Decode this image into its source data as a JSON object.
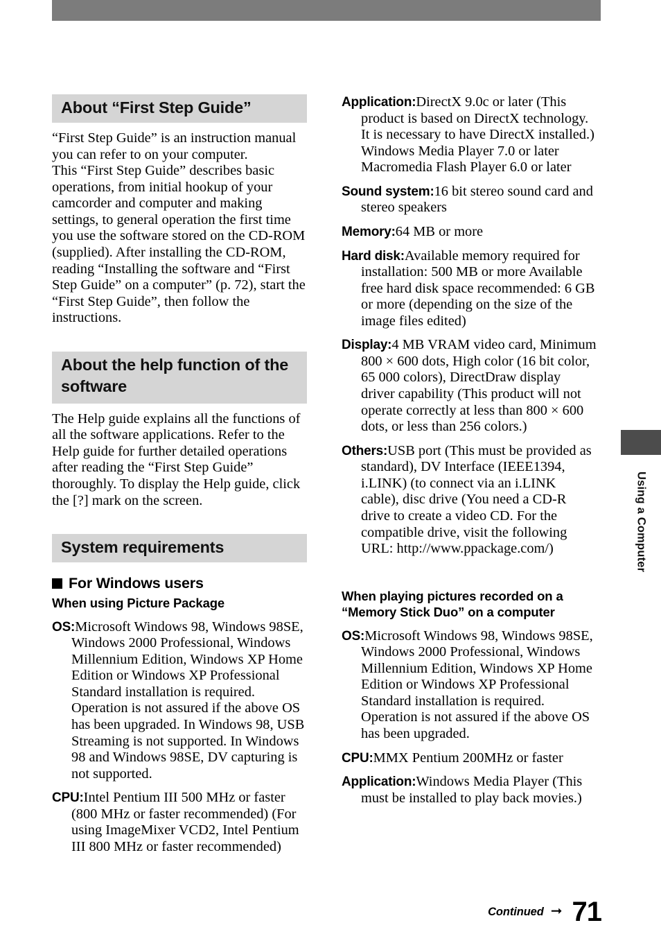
{
  "page": {
    "number": "71",
    "continued_label": "Continued",
    "arrow_icon": "right-arrow-icon",
    "side_tab_label": "Using a Computer"
  },
  "left_column": {
    "heading_1": "About “First Step Guide”",
    "para_1": "“First Step Guide” is an instruction manual you can refer to on your computer.",
    "para_2": "This “First Step Guide” describes basic operations, from initial hookup of your camcorder and computer and making settings, to general operation the first time you use the software stored on the CD-ROM (supplied). After installing the CD-ROM, reading “Installing the software and “First Step Guide” on a computer” (p. 72), start the “First Step Guide”, then follow the instructions.",
    "heading_2": "About the help function of the software",
    "para_3": "The Help guide explains all the functions of all the software applications. Refer to the Help guide for further detailed operations after reading the “First Step Guide” thoroughly. To display the Help guide, click the [?] mark on the screen.",
    "heading_3": "System requirements",
    "subheading_windows": "For Windows users",
    "subheading_picture_package": "When using Picture Package",
    "specs": [
      {
        "term": "OS:",
        "value": "Microsoft Windows 98, Windows 98SE, Windows 2000 Professional, Windows Millennium Edition, Windows XP Home Edition or Windows XP Professional Standard installation is required. Operation is not assured if the above OS has been upgraded. In Windows 98, USB Streaming is not supported. In Windows 98 and Windows 98SE, DV capturing is not supported."
      },
      {
        "term": "CPU:",
        "value": "Intel Pentium III 500 MHz or faster (800 MHz or faster recommended) (For using ImageMixer VCD2, Intel Pentium III 800 MHz or faster recommended)"
      }
    ]
  },
  "right_column": {
    "specs_picture_package": [
      {
        "term": "Application:",
        "value": "DirectX 9.0c or later (This product is based on DirectX technology. It is necessary to have DirectX installed.) Windows Media Player 7.0 or later Macromedia Flash Player 6.0 or later"
      },
      {
        "term": "Sound system:",
        "value": "16 bit stereo sound card and stereo speakers"
      },
      {
        "term": "Memory:",
        "value": "64 MB or more"
      },
      {
        "term": "Hard disk:",
        "value": "Available memory required for installation: 500 MB or more Available free hard disk space recommended: 6 GB or more (depending on the size of the image files edited)"
      },
      {
        "term": "Display:",
        "value": "4 MB VRAM video card, Minimum 800 × 600 dots, High color (16 bit color, 65 000 colors), DirectDraw display driver capability (This product will not operate correctly at less than 800 × 600 dots, or less than 256 colors.)"
      },
      {
        "term": "Others:",
        "value": "USB port (This must be provided as standard), DV Interface (IEEE1394, i.LINK) (to connect via an i.LINK cable), disc drive (You need a CD-R drive to create a video CD. For the compatible drive, visit the following URL: http://www.ppackage.com/)"
      }
    ],
    "subheading_memory_stick": "When playing pictures recorded on a “Memory Stick Duo” on a computer",
    "specs_memory_stick": [
      {
        "term": "OS:",
        "value": "Microsoft Windows 98, Windows 98SE, Windows 2000 Professional, Windows Millennium Edition, Windows XP Home Edition or Windows XP Professional Standard installation is required. Operation is not assured if the above OS has been upgraded."
      },
      {
        "term": "CPU:",
        "value": "MMX Pentium 200MHz or faster"
      },
      {
        "term": "Application:",
        "value": "Windows Media Player (This must be installed to play back movies.)"
      }
    ]
  },
  "colors": {
    "top_bar": "#7c7c7c",
    "heading_band": "#d5d5d5",
    "side_tab_block": "#4c4c4c"
  }
}
